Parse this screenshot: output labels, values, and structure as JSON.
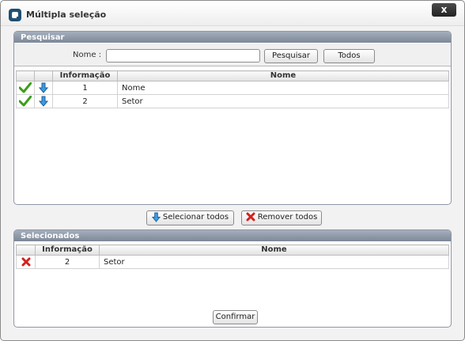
{
  "dialog": {
    "title": "Múltipla seleção",
    "close_label": "x",
    "app_icon": "app-logo-icon",
    "accent_color": "#7d8898"
  },
  "search_panel": {
    "title": "Pesquisar",
    "name_label": "Nome :",
    "name_value": "",
    "name_placeholder": "",
    "search_button": "Pesquisar",
    "all_button": "Todos"
  },
  "results_table": {
    "columns": [
      "",
      "",
      "Informação",
      "Nome"
    ],
    "rows": [
      {
        "info": "1",
        "name": "Nome",
        "icons": [
          "check-icon",
          "arrow-down-icon"
        ]
      },
      {
        "info": "2",
        "name": "Setor",
        "icons": [
          "check-icon",
          "arrow-down-icon"
        ]
      }
    ]
  },
  "actions": {
    "select_all": "Selecionar todos",
    "select_all_icon": "arrow-down-icon",
    "remove_all": "Remover todos",
    "remove_all_icon": "remove-icon"
  },
  "selected_panel": {
    "title": "Selecionados",
    "columns": [
      "",
      "Informação",
      "Nome"
    ],
    "rows": [
      {
        "info": "2",
        "name": "Setor",
        "icons": [
          "remove-icon"
        ]
      }
    ],
    "confirm_button": "Confirmar"
  }
}
